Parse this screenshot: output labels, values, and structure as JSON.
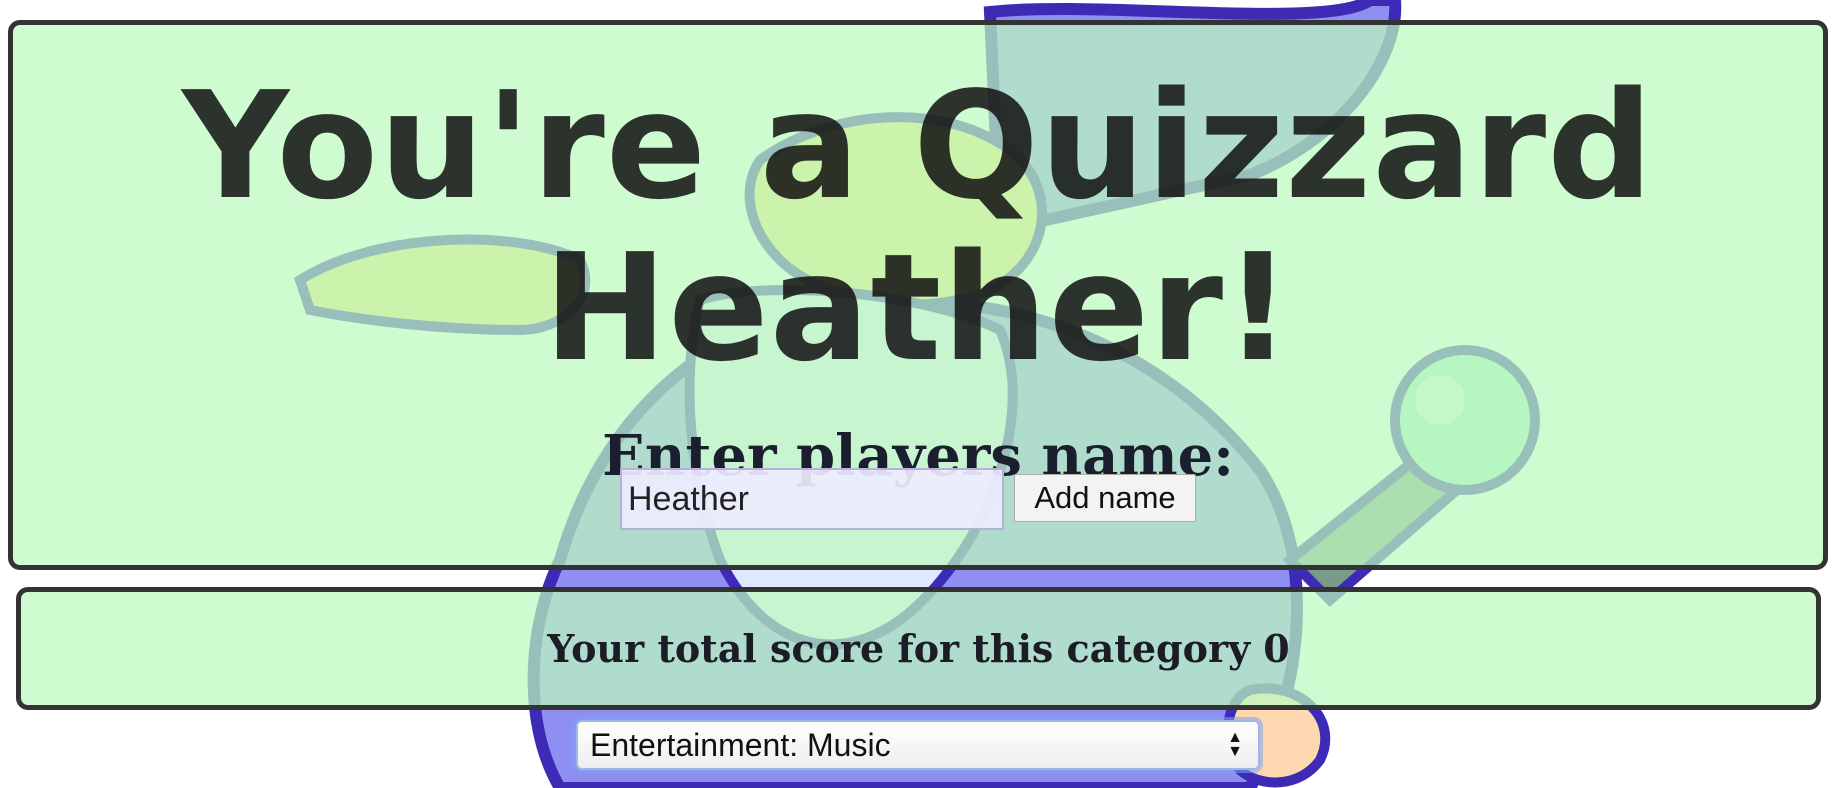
{
  "header": {
    "title": "You're a Quizzard Heather!",
    "prompt": "Enter players name:"
  },
  "name_form": {
    "input_value": "Heather",
    "button_label": "Add name"
  },
  "score": {
    "text": "Your total score for this category 0"
  },
  "category_select": {
    "selected": "Entertainment: Music"
  },
  "icons": {
    "background": "wizard-mascot-icon",
    "select_arrows": "up-down-arrows-icon"
  },
  "colors": {
    "panel_background": "#c8fac9",
    "panel_border": "#333333",
    "wizard_purple": "#8f8ff2",
    "wizard_outline": "#3d2ab5",
    "staff_green": "#a6f0c8"
  }
}
